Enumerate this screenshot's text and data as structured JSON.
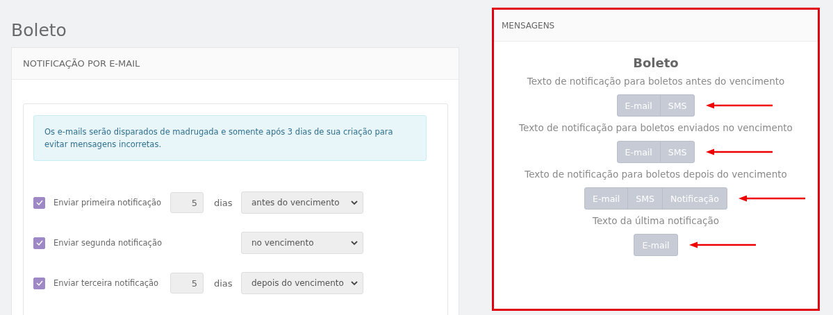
{
  "page_title": "Boleto",
  "email_card": {
    "header": "NOTIFICAÇÃO POR E-MAIL",
    "alert": "Os e-mails serão disparados de madrugada e somente após 3 dias de sua criação para evitar mensagens incorretas.",
    "rows": [
      {
        "label": "Enviar primeira notificação",
        "checked": true,
        "days": "5",
        "unit": "dias",
        "when": "antes do vencimento"
      },
      {
        "label": "Enviar segunda notificação",
        "checked": true,
        "when": "no vencimento"
      },
      {
        "label": "Enviar terceira notificação",
        "checked": true,
        "days": "5",
        "unit": "dias",
        "when": "depois do vencimento"
      }
    ]
  },
  "messages_card": {
    "header": "MENSAGENS",
    "title": "Boleto",
    "highlighted": true,
    "groups": [
      {
        "label": "Texto de notificação para boletos antes do vencimento",
        "buttons": [
          "E-mail",
          "SMS"
        ],
        "arrow": true
      },
      {
        "label": "Texto de notificação para boletos enviados no vencimento",
        "buttons": [
          "E-mail",
          "SMS"
        ],
        "arrow": true
      },
      {
        "label": "Texto de notificação para boletos depois do vencimento",
        "buttons": [
          "E-mail",
          "SMS",
          "Notificação"
        ],
        "arrow": true
      },
      {
        "label": "Texto da última notificação",
        "buttons": [
          "E-mail"
        ],
        "arrow": true
      }
    ]
  }
}
